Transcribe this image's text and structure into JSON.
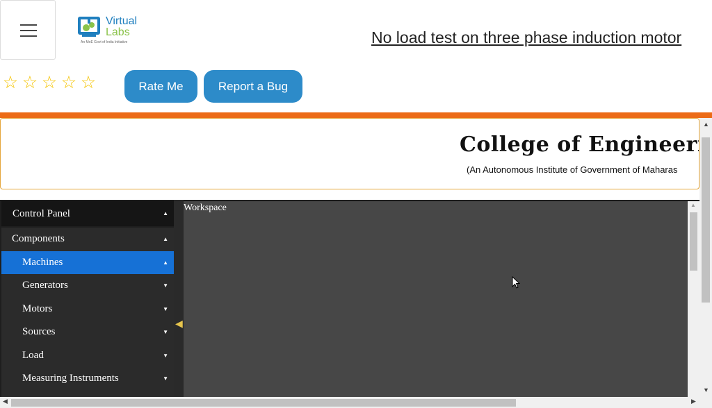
{
  "header": {
    "logo_line1": "Virtual",
    "logo_line2": "Labs",
    "logo_tagline": "An MoE Govt of India Initiative",
    "title": "No load test on three phase induction motor"
  },
  "rating": {
    "stars": [
      "☆",
      "☆",
      "☆",
      "☆",
      "☆"
    ],
    "rate_label": "Rate Me",
    "bug_label": "Report a Bug"
  },
  "banner": {
    "college": "College of Engineering,",
    "subtitle": "(An Autonomous Institute of Government of Maharas"
  },
  "app": {
    "panel_title": "Control Panel",
    "sections": [
      {
        "label": "Components",
        "caret": "▲"
      },
      {
        "label": "Machines",
        "caret": "▲"
      },
      {
        "label": "Generators",
        "caret": "▼"
      },
      {
        "label": "Motors",
        "caret": "▼"
      },
      {
        "label": "Sources",
        "caret": "▼"
      },
      {
        "label": "Load",
        "caret": "▼"
      },
      {
        "label": "Measuring Instruments",
        "caret": "▼"
      }
    ],
    "panel_caret": "▲",
    "workspace_label": "Workspace"
  },
  "colors": {
    "accent_orange": "#ec6b16",
    "button_blue": "#2d8bc9",
    "active_blue": "#1671d6",
    "star_gold": "#f5c400"
  }
}
